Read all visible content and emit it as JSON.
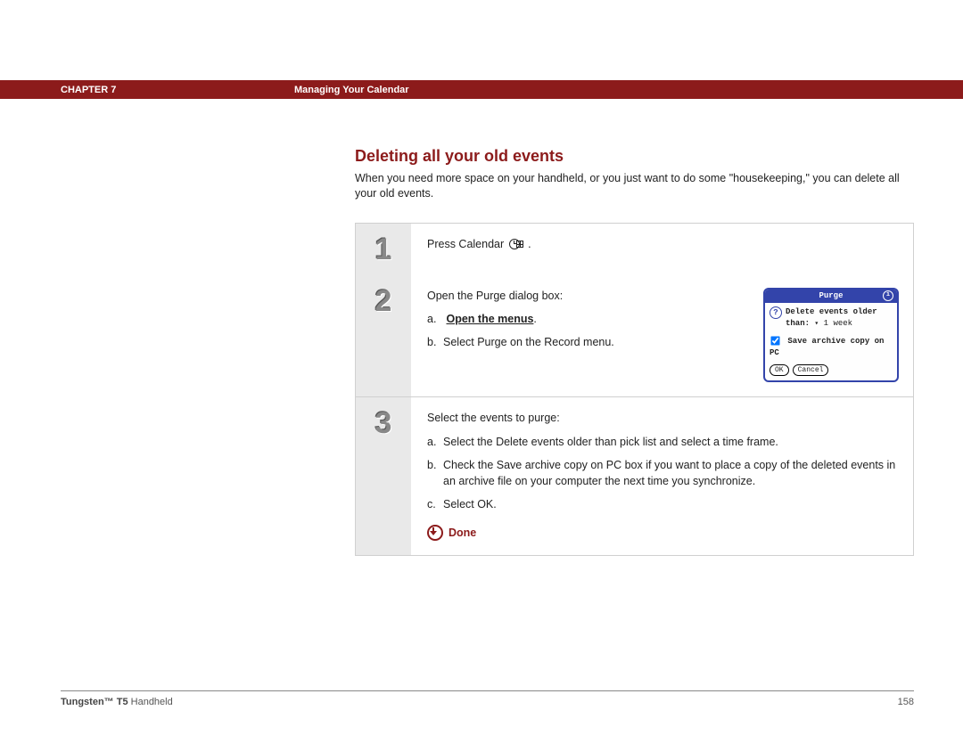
{
  "header": {
    "chapter_label": "CHAPTER 7",
    "chapter_title": "Managing Your Calendar"
  },
  "section": {
    "title": "Deleting all your old events",
    "intro": "When you need more space on your handheld, or you just want to do some \"housekeeping,\" you can delete all your old events."
  },
  "steps": {
    "s1": {
      "num": "1",
      "text_pre": "Press Calendar ",
      "text_post": "."
    },
    "s2": {
      "num": "2",
      "lead": "Open the Purge dialog box:",
      "a_letter": "a.",
      "a_text": "Open the menus",
      "a_period": ".",
      "b_letter": "b.",
      "b_text": "Select Purge on the Record menu."
    },
    "s3": {
      "num": "3",
      "lead": "Select the events to purge:",
      "a_letter": "a.",
      "a_text": "Select the Delete events older than pick list and select a time frame.",
      "b_letter": "b.",
      "b_text": "Check the Save archive copy on PC box if you want to place a copy of the deleted events in an archive file on your computer the next time you synchronize.",
      "c_letter": "c.",
      "c_text": "Select OK."
    },
    "done_label": "Done"
  },
  "palm": {
    "title": "Purge",
    "line1a": "Delete events older",
    "line1b": "than:",
    "dropdown_value": "1 week",
    "checkbox_label": "Save archive copy on PC",
    "ok": "OK",
    "cancel": "Cancel"
  },
  "footer": {
    "product_bold": "Tungsten™ T5",
    "product_rest": " Handheld",
    "page_number": "158"
  }
}
